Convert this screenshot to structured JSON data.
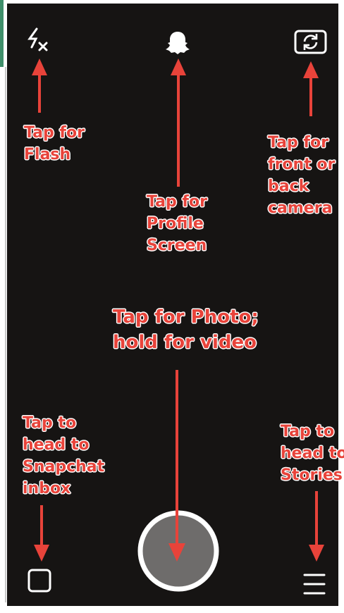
{
  "camera_screen": {
    "flash_button_icon": "flash-off-icon",
    "profile_button_icon": "ghost-icon",
    "flip_camera_button_icon": "camera-flip-icon",
    "shutter_button_icon": "shutter-icon",
    "inbox_button_icon": "square-icon",
    "stories_button_icon": "menu-icon"
  },
  "annotations": {
    "flash": "Tap for\nFlash",
    "profile": "Tap for\nProfile\nScreen",
    "flip_camera": "Tap for\nfront or\nback\ncamera",
    "shutter": "Tap for Photo;\nhold for video",
    "inbox": "Tap to\nhead to\nSnapchat\ninbox",
    "stories": "Tap to\nhead to\nStories"
  },
  "colors": {
    "background": "#161413",
    "annotation_red": "#e8433a",
    "annotation_outline": "#ffffff",
    "icon_white": "#ffffff",
    "shutter_fill": "#6e6c6b"
  }
}
